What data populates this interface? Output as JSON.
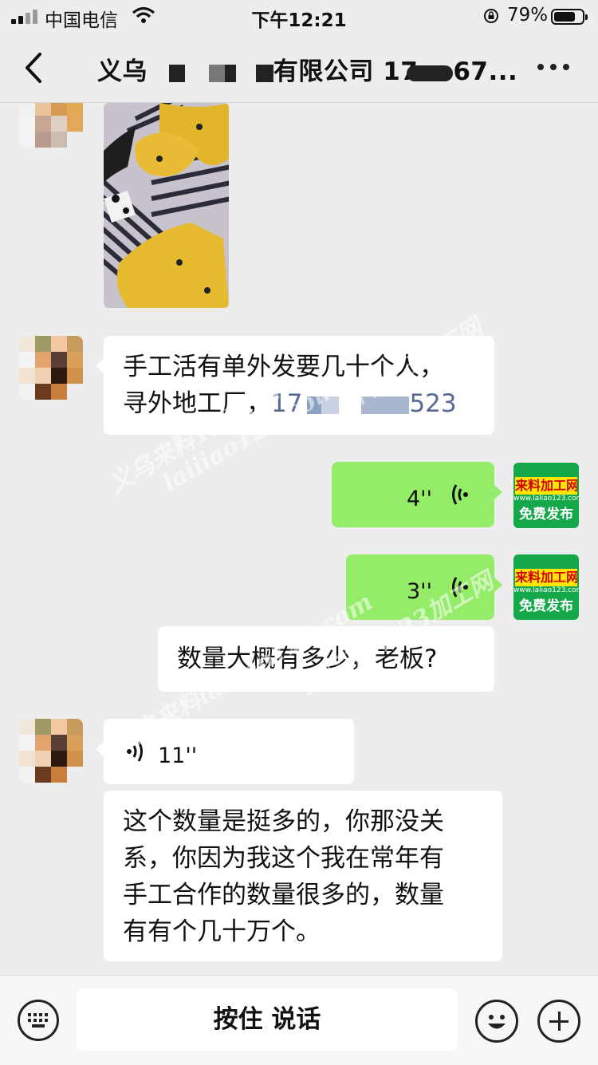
{
  "status_bar": {
    "carrier": "中国电信",
    "time": "下午12:21",
    "battery": "79%"
  },
  "nav": {
    "title_prefix": "义乌",
    "title_mid": "有限公司",
    "title_suffix": "17",
    "title_tail": "67...",
    "back_icon": "chevron-left-icon",
    "more_icon": "more-icon"
  },
  "messages": [
    {
      "side": "left",
      "type": "image"
    },
    {
      "side": "left",
      "type": "text",
      "line1": "手工活有单外发要几十个人，",
      "line2_text": "寻外地工厂，",
      "phone_start": "17",
      "phone_end": "523"
    },
    {
      "side": "right",
      "type": "voice",
      "duration": "4''"
    },
    {
      "side": "right",
      "type": "voice",
      "duration": "3''"
    },
    {
      "side": "right",
      "type": "text",
      "text": "数量大概有多少，老板?"
    },
    {
      "side": "left",
      "type": "voice",
      "duration": "11''"
    },
    {
      "side": "left",
      "type": "text",
      "lines": [
        "这个数量是挺多的，你那没关",
        "系，你因为我这个我在常年有",
        "手工合作的数量很多的，数量",
        "有有个几十万个。"
      ]
    }
  ],
  "ad_avatar": {
    "title": "来料加工网",
    "url": "www.laliao123.com",
    "free": "免费发布"
  },
  "watermarks": [
    "料123加工网",
    "义乌来料123.com",
    "laiiiao123.com",
    "义乌来料123加工网",
    "义乌来料laiiiao123.com"
  ],
  "input_bar": {
    "hold_to_talk": "按住 说话"
  },
  "colors": {
    "background": "#ededed",
    "sent_bubble": "#95ec69",
    "received_bubble": "#ffffff",
    "link": "#576b95"
  }
}
